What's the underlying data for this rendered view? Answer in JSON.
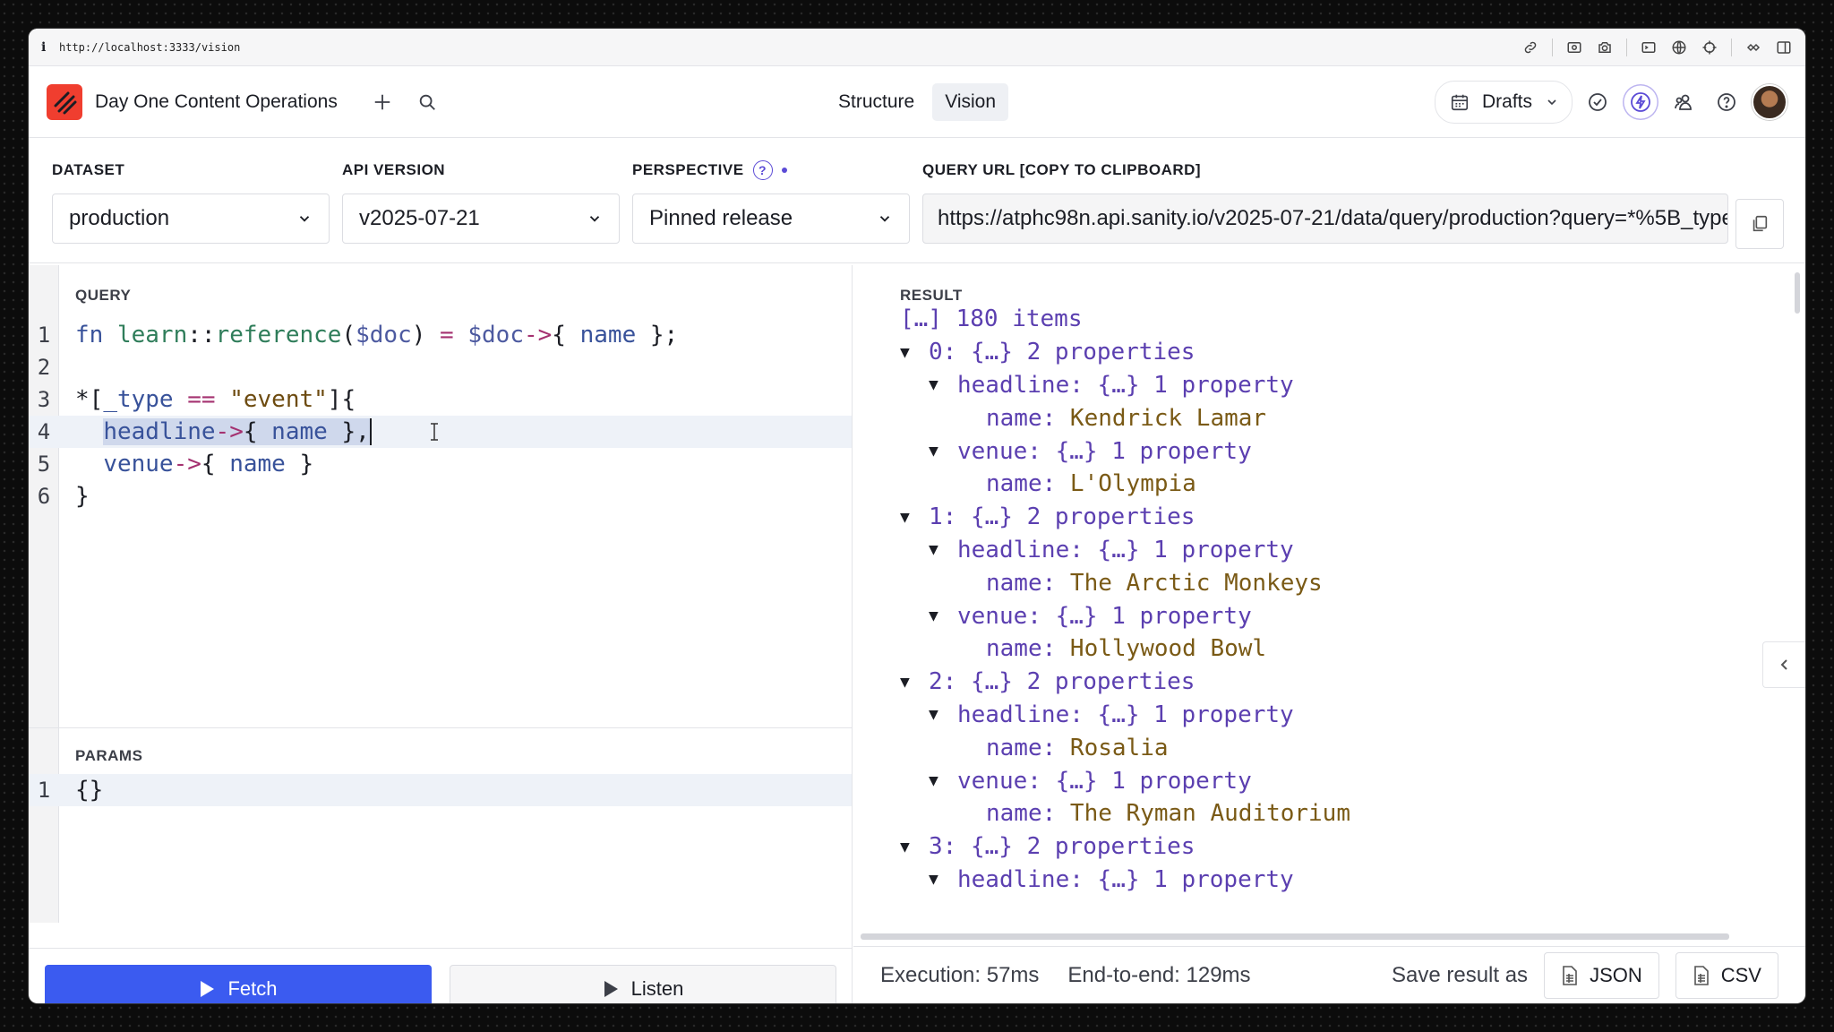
{
  "browser": {
    "url": "http://localhost:3333/vision",
    "info_icon": "info-icon"
  },
  "header": {
    "project_name": "Day One Content Operations",
    "tabs": [
      {
        "label": "Structure"
      },
      {
        "label": "Vision"
      }
    ],
    "perspective_selector": "Drafts"
  },
  "settings": {
    "dataset": {
      "label": "DATASET",
      "value": "production"
    },
    "api_version": {
      "label": "API VERSION",
      "value": "v2025-07-21"
    },
    "perspective": {
      "label": "PERSPECTIVE",
      "value": "Pinned release"
    },
    "query_url": {
      "label": "QUERY URL [COPY TO CLIPBOARD]",
      "value": "https://atphc98n.api.sanity.io/v2025-07-21/data/query/production?query=*%5B_type"
    }
  },
  "query": {
    "label": "QUERY",
    "line_numbers": [
      "1",
      "2",
      "3",
      "4",
      "5",
      "6"
    ]
  },
  "params": {
    "label": "PARAMS",
    "line_numbers": [
      "1"
    ],
    "value": "{}"
  },
  "actions": {
    "fetch": "Fetch",
    "listen": "Listen"
  },
  "result": {
    "label": "RESULT",
    "summary": "[…] 180 items",
    "items": [
      {
        "index": "0",
        "headline": "Kendrick Lamar",
        "venue": "L'Olympia"
      },
      {
        "index": "1",
        "headline": "The Arctic Monkeys",
        "venue": "Hollywood Bowl"
      },
      {
        "index": "2",
        "headline": "Rosalia",
        "venue": "The Ryman Auditorium"
      },
      {
        "index": "3"
      }
    ],
    "obj_two": "{…} 2 properties",
    "obj_one": "{…} 1 property"
  },
  "footer": {
    "execution": "Execution: 57ms",
    "end_to_end": "End-to-end: 129ms",
    "save_label": "Save result as",
    "json_btn": "JSON",
    "csv_btn": "CSV"
  },
  "colors": {
    "accent": "#3b5bf0",
    "brand": "#f03e2f",
    "purple": "#5b4bd6"
  }
}
